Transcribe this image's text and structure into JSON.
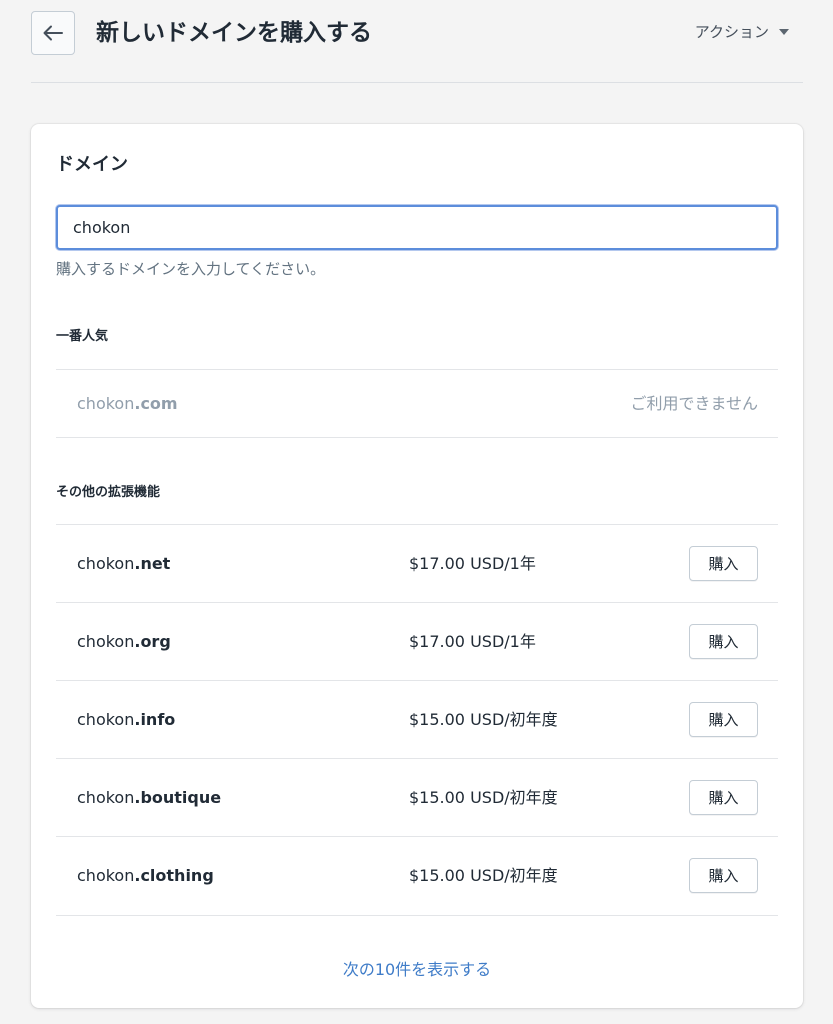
{
  "header": {
    "title": "新しいドメインを購入する",
    "actions_label": "アクション"
  },
  "card": {
    "title": "ドメイン",
    "search": {
      "value": "chokon"
    },
    "help_text": "購入するドメインを入力してください。",
    "popular": {
      "label": "一番人気",
      "item": {
        "name": "chokon",
        "ext": ".com",
        "status": "ご利用できません"
      }
    },
    "others": {
      "label": "その他の拡張機能",
      "items": [
        {
          "name": "chokon",
          "ext": ".net",
          "price": "$17.00 USD/1年",
          "button": "購入"
        },
        {
          "name": "chokon",
          "ext": ".org",
          "price": "$17.00 USD/1年",
          "button": "購入"
        },
        {
          "name": "chokon",
          "ext": ".info",
          "price": "$15.00 USD/初年度",
          "button": "購入"
        },
        {
          "name": "chokon",
          "ext": ".boutique",
          "price": "$15.00 USD/初年度",
          "button": "購入"
        },
        {
          "name": "chokon",
          "ext": ".clothing",
          "price": "$15.00 USD/初年度",
          "button": "購入"
        }
      ]
    },
    "more_link": "次の10件を表示する"
  },
  "colors": {
    "accent_link": "#3f7cc8",
    "input_focus": "#5c8ddb",
    "muted_text": "#919eab"
  }
}
